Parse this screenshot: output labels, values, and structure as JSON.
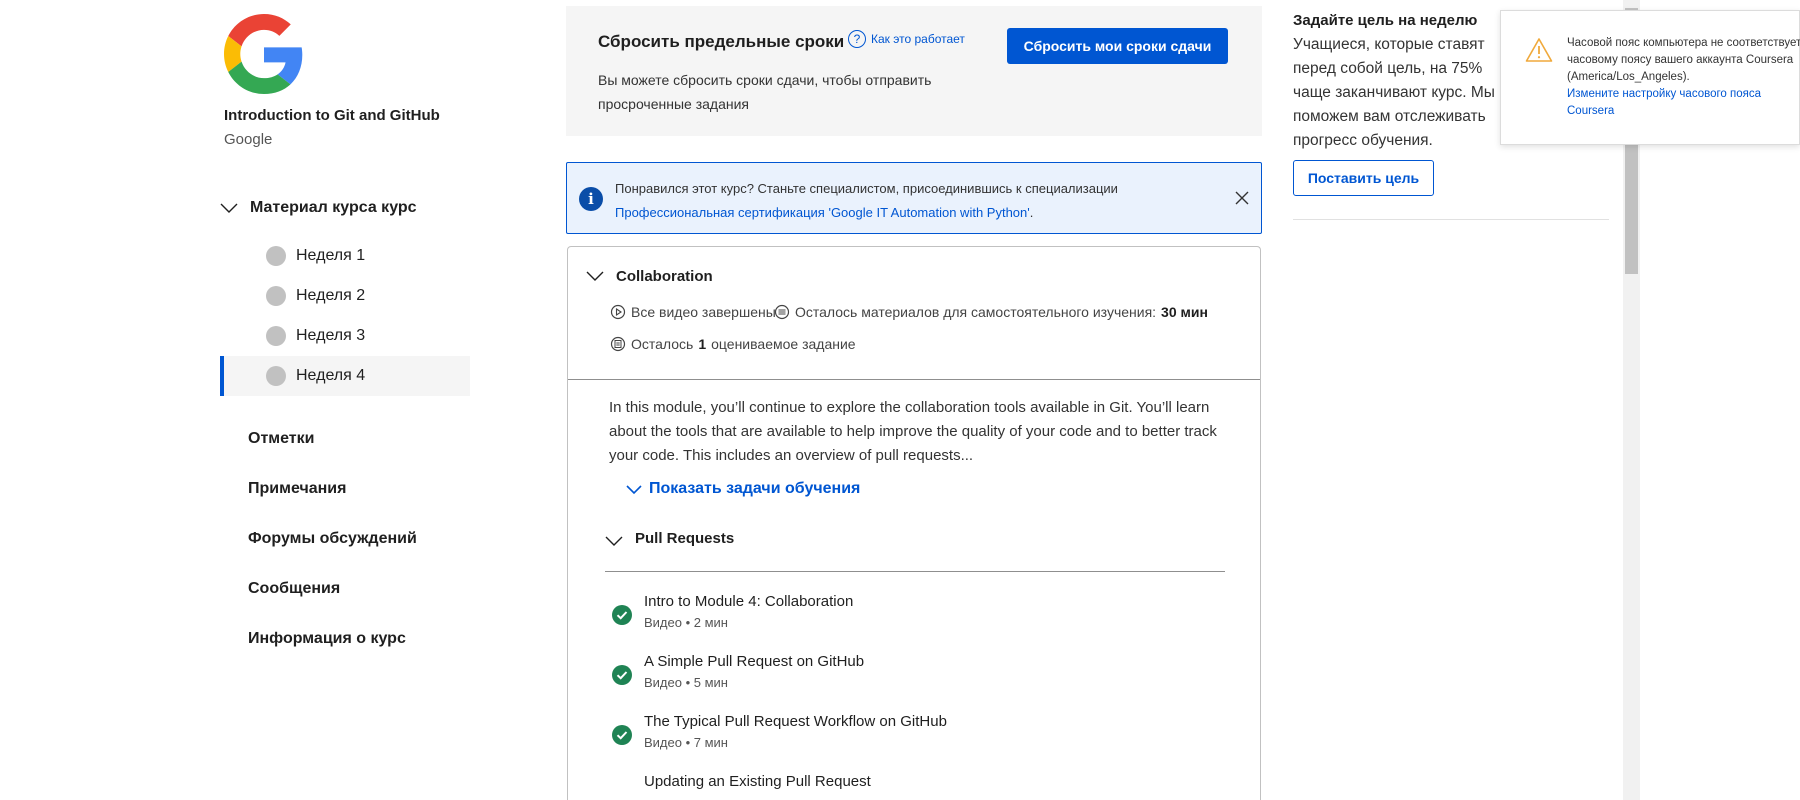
{
  "course": {
    "title": "Introduction to Git and GitHub",
    "partner": "Google"
  },
  "sidebar": {
    "material_label": "Материал курса курс",
    "weeks": [
      {
        "label": "Неделя 1",
        "active": false
      },
      {
        "label": "Неделя 2",
        "active": false
      },
      {
        "label": "Неделя 3",
        "active": false
      },
      {
        "label": "Неделя 4",
        "active": true
      }
    ],
    "links": [
      "Отметки",
      "Примечания",
      "Форумы обсуждений",
      "Сообщения",
      "Информация о курс"
    ]
  },
  "reset": {
    "title": "Сбросить предельные сроки",
    "how_link": "Как это работает",
    "description": "Вы можете сбросить сроки сдачи, чтобы отправить просроченные задания",
    "button": "Сбросить мои сроки сдачи"
  },
  "banner": {
    "text": "Понравился этот курс? Станьте специалистом, присоединившись к специализации",
    "link": "Профессиональная сертификация 'Google IT Automation with Python'",
    "link_suffix": "."
  },
  "module": {
    "title": "Collaboration",
    "meta_videos": "Все видео завершены",
    "meta_reading_prefix": "Осталось материалов для самостоятельного изучения:",
    "meta_reading_value": "30 мин",
    "meta_graded_prefix": "Осталось",
    "meta_graded_count": "1",
    "meta_graded_suffix": "оцениваемое задание",
    "description": "In this module, you’ll continue to explore the collaboration tools available in Git. You’ll learn about the tools that are available to help improve the quality of your code and to better track your code. This includes an overview of pull requests...",
    "show_tasks": "Показать задачи обучения",
    "lesson_title": "Pull Requests",
    "items": [
      {
        "name": "Intro to Module 4: Collaboration",
        "type": "Видео",
        "duration": "2 мин"
      },
      {
        "name": "A Simple Pull Request on GitHub",
        "type": "Видео",
        "duration": "5 мин"
      },
      {
        "name": "The Typical Pull Request Workflow on GitHub",
        "type": "Видео",
        "duration": "7 мин"
      },
      {
        "name": "Updating an Existing Pull Request",
        "type": "",
        "duration": ""
      }
    ]
  },
  "goal": {
    "title": "Задайте цель на неделю",
    "text": "Учащиеся, которые ставят перед собой цель, на 75% чаще заканчивают курс. Мы поможем вам отслеживать прогресс обучения.",
    "button": "Поставить цель"
  },
  "toast": {
    "line1": "Часовой пояс компьютера не соответствует",
    "line2": "часовому поясу вашего аккаунта Coursera",
    "line3": "(America/Los_Angeles).",
    "link1": "Измените настройку часового пояса",
    "link2": "Coursera"
  },
  "colors": {
    "accent": "#0056d2",
    "complete": "#1f8354",
    "warning": "#f0a93b"
  }
}
